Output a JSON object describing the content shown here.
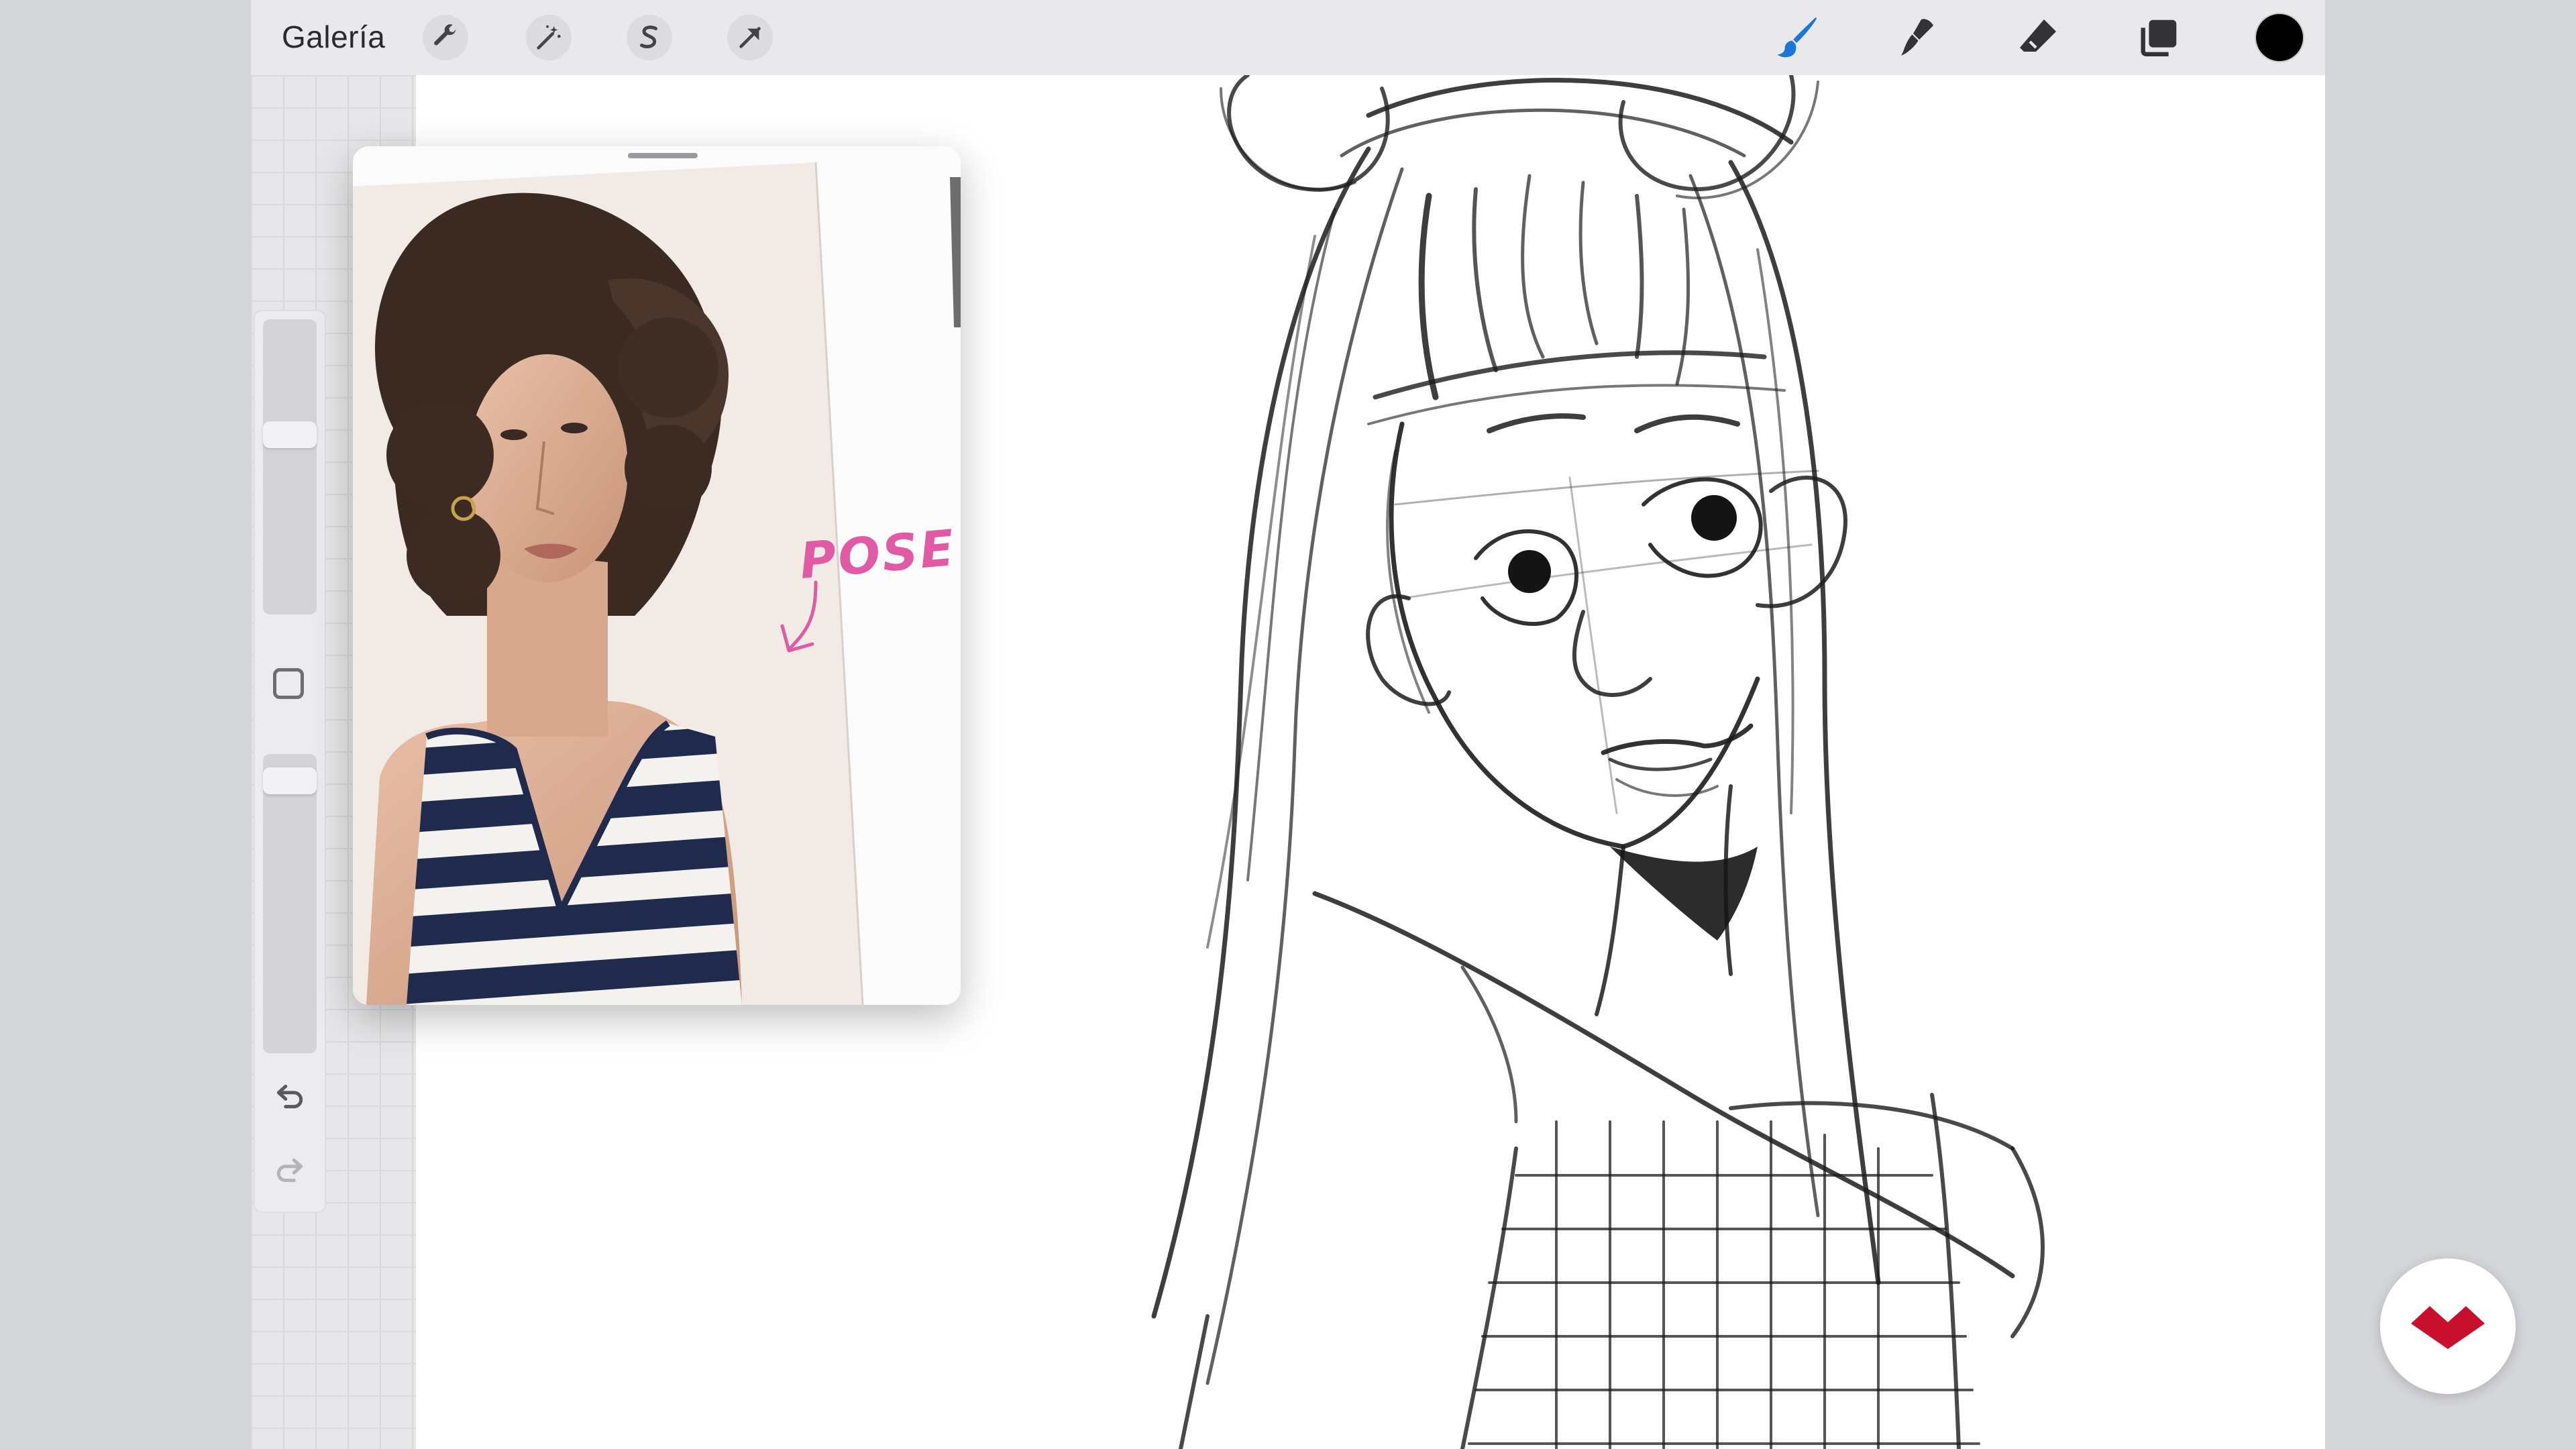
{
  "toolbar": {
    "gallery_label": "Galería",
    "left_tools": [
      {
        "id": "actions",
        "icon": "wrench-icon"
      },
      {
        "id": "adjustments",
        "icon": "magic-wand-icon"
      },
      {
        "id": "selection",
        "icon": "selection-s-icon"
      },
      {
        "id": "transform",
        "icon": "arrow-cursor-icon"
      }
    ],
    "right_tools": [
      {
        "id": "brush",
        "icon": "brush-icon",
        "active": true
      },
      {
        "id": "smudge",
        "icon": "smudge-icon"
      },
      {
        "id": "eraser",
        "icon": "eraser-icon"
      },
      {
        "id": "layers",
        "icon": "layers-icon"
      },
      {
        "id": "color",
        "icon": "color-swatch",
        "value": "#000000"
      }
    ]
  },
  "sidebar": {
    "brush_size_level": 0.38,
    "opacity_level": 0.05,
    "controls": [
      "modify-button",
      "undo-icon",
      "redo-icon"
    ]
  },
  "reference": {
    "annotation": "POSE"
  },
  "colors": {
    "accent": "#1b76d8",
    "annotation": "#e05aa6",
    "logo": "#c8102e",
    "paper": "#ffffff",
    "toolbar": "#e9e9eb"
  }
}
